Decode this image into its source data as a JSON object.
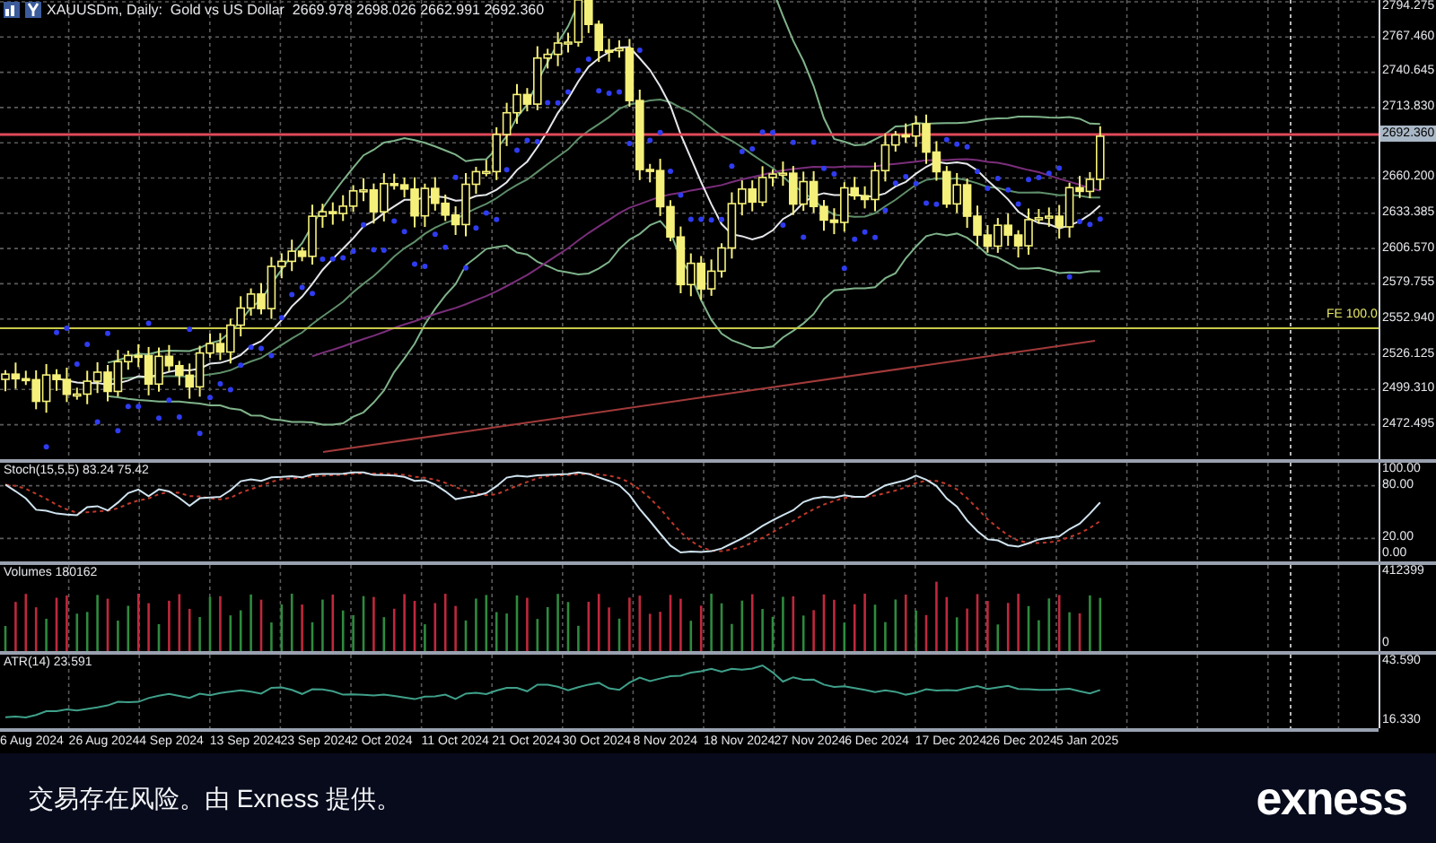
{
  "chart_header": {
    "symbol_info": "XAUUSDm, Daily:  Gold vs US Dollar  2669.978 2698.026 2662.991 2692.360"
  },
  "price_axis": [
    "2794.275",
    "2767.460",
    "2740.645",
    "2713.830",
    "2660.200",
    "2633.385",
    "2606.570",
    "2579.755",
    "2552.940",
    "2526.125",
    "2499.310",
    "2472.495"
  ],
  "current_price": "2692.360",
  "level_label": "FE 100.0",
  "panes": [
    {
      "kind": "stochastic",
      "label": "Stoch(15,5,5) 83.24 75.42",
      "axis": [
        "100.00",
        "80.00",
        "20.00",
        "0.00"
      ]
    },
    {
      "kind": "volumes",
      "label": "Volumes 180162",
      "axis": [
        "412399",
        "0"
      ]
    },
    {
      "kind": "atr",
      "label": "ATR(14) 23.591",
      "axis": [
        "43.590",
        "16.330"
      ]
    }
  ],
  "date_axis": [
    "6 Aug 2024",
    "26 Aug 2024",
    "4 Sep 2024",
    "13 Sep 2024",
    "23 Sep 2024",
    "2 Oct 2024",
    "11 Oct 2024",
    "21 Oct 2024",
    "30 Oct 2024",
    "8 Nov 2024",
    "18 Nov 2024",
    "27 Nov 2024",
    "6 Dec 2024",
    "17 Dec 2024",
    "26 Dec 2024",
    "5 Jan 2025"
  ],
  "footer": {
    "disclaimer": "交易存在风险。由 Exness 提供。",
    "logo": "exness"
  }
}
